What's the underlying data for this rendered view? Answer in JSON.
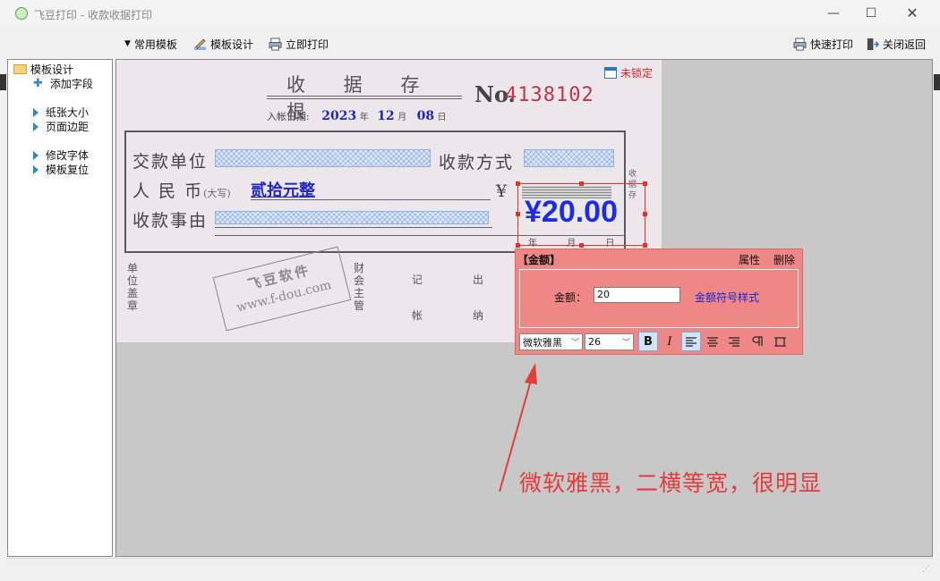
{
  "window": {
    "title": "飞豆打印 - 收款收据打印"
  },
  "toolbar": {
    "templates_label": "常用模板",
    "design_label": "模板设计",
    "print_now_label": "立即打印",
    "quick_print_label": "快速打印",
    "close_label": "关闭返回"
  },
  "sidebar": {
    "root_label": "模板设计",
    "add_field_label": "添加字段",
    "items": [
      {
        "label": "纸张大小"
      },
      {
        "label": "页面边距"
      },
      {
        "label": "修改字体"
      },
      {
        "label": "模板复位"
      }
    ]
  },
  "receipt": {
    "title": "收 据 存 根",
    "no_label": "No.",
    "no_value": "4138102",
    "date_label": "入帐日期:",
    "year": "2023",
    "year_unit": "年",
    "month": "12",
    "month_unit": "月",
    "day": "08",
    "day_unit": "日",
    "payer_label": "交款单位",
    "method_label": "收款方式",
    "rmb_label": "人 民 币",
    "rmb_sub": "(大写)",
    "rmb_value": "贰拾元整",
    "yen": "¥",
    "reason_label": "收款事由",
    "amount_display": "¥20.00",
    "side_text": "收据存",
    "bottom_date": [
      "年",
      "月",
      "日"
    ],
    "col_unit": "单位盖章",
    "col_acct": "财会主管",
    "col_book": "记帐",
    "col_cash": "出纳",
    "stamp_line1": "飞豆软件",
    "stamp_line2": "www.f-dou.com"
  },
  "lock_status": "未锁定",
  "popup": {
    "title": "【金额】",
    "props_label": "属性",
    "delete_label": "删除",
    "field_label": "金额：",
    "field_value": "20",
    "style_link": "金额符号样式",
    "font_name": "微软雅黑",
    "font_size": "26",
    "bold": "B",
    "italic": "I"
  },
  "annotation": "微软雅黑，二横等宽，很明显",
  "colors": {
    "accent_red": "#e8312c",
    "amount_blue": "#1b2ee6",
    "popup_bg": "#f08787"
  }
}
